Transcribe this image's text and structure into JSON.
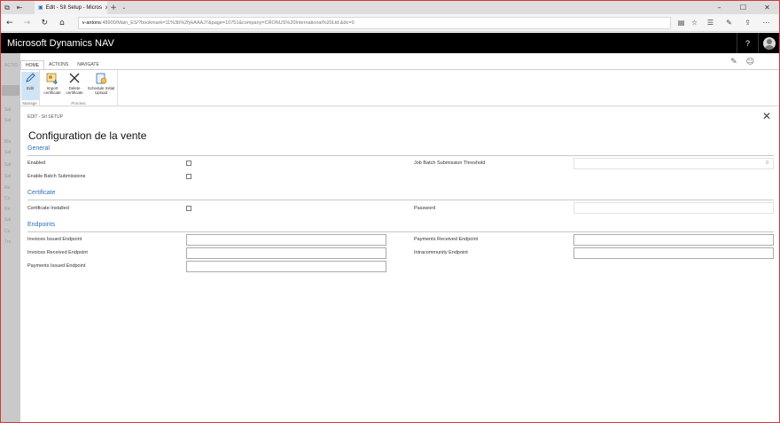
{
  "browser": {
    "tab_title": "Edit - SII Setup - Micros",
    "address_host": "v-antons",
    "address_path": ":48900/Main_ES/?bookmark=11%3b%2fykAAAJ7&page=10751&company=CRONUS%20International%20Ltd.&dc=0"
  },
  "app": {
    "title": "Microsoft Dynamics NAV",
    "help_label": "?"
  },
  "background_page": {
    "actions_label": "ACTIO",
    "items": [
      "Sal",
      "Sal",
      "Bla",
      "Sal",
      "Sal",
      "Sal",
      "Re",
      "Co",
      "Re",
      "Sal",
      "Co",
      "Tra"
    ]
  },
  "ribbon": {
    "tabs": [
      "HOME",
      "ACTIONS",
      "NAVIGATE"
    ],
    "groups": {
      "manage": {
        "label": "Manage",
        "buttons": [
          {
            "line1": "Edit",
            "line2": ""
          }
        ]
      },
      "process": {
        "label": "Process",
        "buttons": [
          {
            "line1": "Import",
            "line2": "certificate"
          },
          {
            "line1": "Delete",
            "line2": "certificate"
          },
          {
            "line1": "Schedule Initial",
            "line2": "Upload"
          }
        ]
      }
    }
  },
  "breadcrumb": "EDIT - SII SETUP",
  "page_title": "Configuration de la vente",
  "sections": {
    "general": {
      "header": "General",
      "enabled_label": "Enabled",
      "enable_batch_label": "Enable Batch Submissions",
      "job_batch_label": "Job Batch Submission Threshold",
      "job_batch_value": "0"
    },
    "certificate": {
      "header": "Certificate",
      "installed_label": "Certificate Installed",
      "password_label": "Password"
    },
    "endpoints": {
      "header": "Endpoints",
      "invoices_issued_label": "Invoices Issued Endpoint",
      "invoices_received_label": "Invoices Received Endpoint",
      "payments_issued_label": "Payments Issued Endpoint",
      "payments_received_label": "Payments Received Endpoint",
      "intracommunity_label": "Intracommunity Endpoint"
    }
  },
  "colors": {
    "accent": "#2f6db5",
    "header_bg": "#000000",
    "frame_border": "#d23a3a"
  }
}
